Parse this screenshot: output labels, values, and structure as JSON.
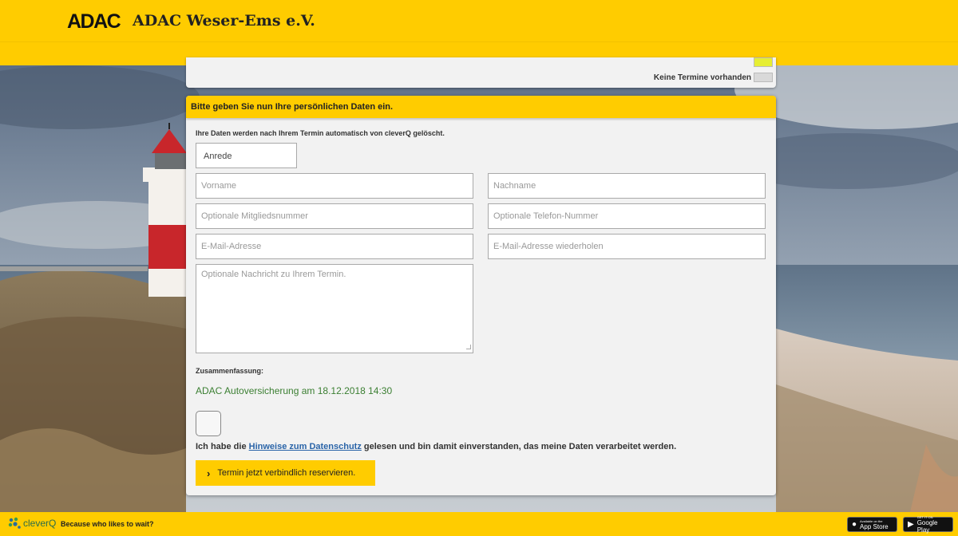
{
  "header": {
    "logo": "ADAC",
    "club_name": "ADAC Weser-Ems e.V."
  },
  "legend": {
    "items": [
      {
        "label": "",
        "color": "#e6ee33"
      },
      {
        "label": "Keine Termine vorhanden",
        "color": "#d9d9d9"
      }
    ]
  },
  "form": {
    "title": "Bitte geben Sie nun Ihre persönlichen Daten ein.",
    "notice": "Ihre Daten werden nach Ihrem Termin automatisch von cleverQ gelöscht.",
    "salutation": {
      "selected": "Anrede"
    },
    "fields": {
      "first_name": {
        "placeholder": "Vorname"
      },
      "last_name": {
        "placeholder": "Nachname"
      },
      "member_number": {
        "placeholder": "Optionale Mitgliedsnummer"
      },
      "phone": {
        "placeholder": "Optionale Telefon-Nummer"
      },
      "email": {
        "placeholder": "E-Mail-Adresse"
      },
      "email_repeat": {
        "placeholder": "E-Mail-Adresse wiederholen"
      },
      "message": {
        "placeholder": "Optionale Nachricht zu Ihrem Termin."
      }
    },
    "summary_label": "Zusammenfassung:",
    "summary_value": "ADAC Autoversicherung am 18.12.2018 14:30",
    "consent": {
      "prefix": "Ich habe die ",
      "link": "Hinweise zum Datenschutz",
      "suffix": " gelesen und bin damit einverstanden, das meine Daten verarbeitet werden."
    },
    "submit_label": "Termin jetzt verbindlich reservieren."
  },
  "footer": {
    "brand": "cleverQ",
    "tagline": "Because who likes to wait?",
    "app_store": {
      "small": "Available on the",
      "big": "App Store"
    },
    "google_play": {
      "small": "GET IT ON",
      "big": "Google Play"
    }
  },
  "colors": {
    "brand_yellow": "#ffcc00",
    "summary_green": "#3b7f32",
    "link_blue": "#2a64a8"
  }
}
